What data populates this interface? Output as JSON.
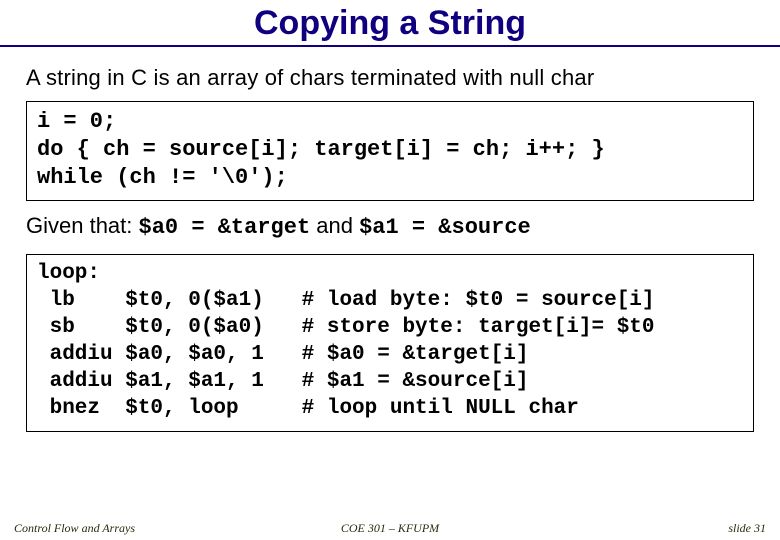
{
  "title": "Copying a String",
  "lead": "A string in C is an array of chars terminated with null char",
  "c_code": "i = 0;\ndo { ch = source[i]; target[i] = ch; i++; }\nwhile (ch != '\\0');",
  "given": {
    "prefix": "Given that: ",
    "a0": "$a0 = &target",
    "mid": " and ",
    "a1": "$a1 = &source"
  },
  "asm_code": "loop:\n lb    $t0, 0($a1)   # load byte: $t0 = source[i]\n sb    $t0, 0($a0)   # store byte: target[i]= $t0\n addiu $a0, $a0, 1   # $a0 = &target[i]\n addiu $a1, $a1, 1   # $a1 = &source[i]\n bnez  $t0, loop     # loop until NULL char",
  "footer": {
    "left": "Control Flow and Arrays",
    "center": "COE 301 – KFUPM",
    "right": "slide 31"
  }
}
